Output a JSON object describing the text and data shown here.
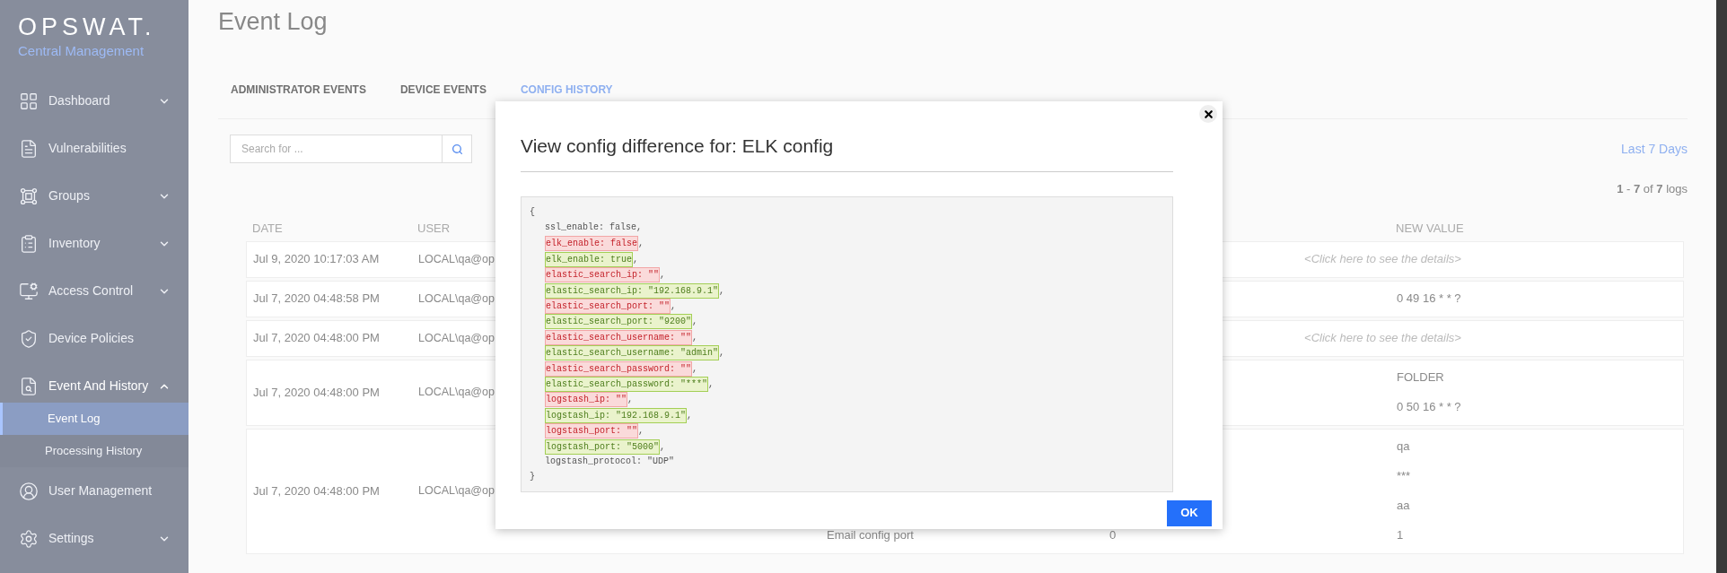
{
  "sidebar": {
    "logo": "OPSWAT.",
    "subtitle": "Central Management",
    "items": [
      {
        "label": "Dashboard",
        "expandable": true,
        "expanded": false
      },
      {
        "label": "Vulnerabilities",
        "expandable": false,
        "expanded": false
      },
      {
        "label": "Groups",
        "expandable": true,
        "expanded": false
      },
      {
        "label": "Inventory",
        "expandable": true,
        "expanded": false
      },
      {
        "label": "Access Control",
        "expandable": true,
        "expanded": false
      },
      {
        "label": "Device Policies",
        "expandable": false,
        "expanded": false
      },
      {
        "label": "Event And History",
        "expandable": true,
        "expanded": true,
        "children": [
          {
            "label": "Event Log",
            "selected": true
          },
          {
            "label": "Processing History",
            "selected": false
          }
        ]
      },
      {
        "label": "User Management",
        "expandable": false,
        "expanded": false
      },
      {
        "label": "Settings",
        "expandable": true,
        "expanded": false
      }
    ]
  },
  "page": {
    "title": "Event Log"
  },
  "tabs": [
    {
      "label": "ADMINISTRATOR EVENTS",
      "selected": false
    },
    {
      "label": "DEVICE EVENTS",
      "selected": false
    },
    {
      "label": "CONFIG HISTORY",
      "selected": true
    }
  ],
  "search": {
    "placeholder": "Search for ..."
  },
  "range": "Last 7 Days",
  "count": "**1** - **7** of **7** logs",
  "table": {
    "columns": [
      "DATE",
      "USER",
      "NEW VALUE"
    ],
    "rows": [
      {
        "date": "Jul 9, 2020 10:17:03 AM",
        "user": "LOCAL\\qa@op",
        "details": "<Click here to see the details>"
      },
      {
        "date": "Jul 7, 2020 04:48:58 PM",
        "user": "LOCAL\\qa@op",
        "lines": [
          {
            "new_value": "0 49 16 * * ?"
          }
        ]
      },
      {
        "date": "Jul 7, 2020 04:48:00 PM",
        "user": "LOCAL\\qa@op",
        "details": "<Click here to see the details>"
      },
      {
        "date": "Jul 7, 2020 04:48:00 PM",
        "user": "LOCAL\\qa@op",
        "lines": [
          {
            "new_value": "FOLDER"
          },
          {
            "new_value": "0 50 16 * * ?"
          }
        ]
      },
      {
        "date": "Jul 7, 2020 04:48:00 PM",
        "user": "LOCAL\\qa@op",
        "lines": [
          {
            "new_value": "qa"
          },
          {
            "new_value": "***"
          },
          {
            "new_value": "aa"
          },
          {
            "column_3": "Email config port",
            "column_4": "0",
            "new_value": "1"
          }
        ]
      }
    ]
  },
  "dialog": {
    "title": "View config difference for: ELK config",
    "button": "OK",
    "code": [
      {
        "kind": "brace",
        "text": "{"
      },
      {
        "kind": "plain",
        "text": "ssl_enable: false,"
      },
      {
        "kind": "removed",
        "text": "elk_enable: false",
        "suffix": ","
      },
      {
        "kind": "added",
        "text": "elk_enable: true",
        "suffix": ","
      },
      {
        "kind": "removed",
        "text": "elastic_search_ip: \"\"",
        "suffix": ","
      },
      {
        "kind": "added",
        "text": "elastic_search_ip: \"192.168.9.1\"",
        "suffix": ","
      },
      {
        "kind": "removed",
        "text": "elastic_search_port: \"\"",
        "suffix": ","
      },
      {
        "kind": "added",
        "text": "elastic_search_port: \"9200\"",
        "suffix": ","
      },
      {
        "kind": "removed",
        "text": "elastic_search_username: \"\"",
        "suffix": ","
      },
      {
        "kind": "added",
        "text": "elastic_search_username: \"admin\"",
        "suffix": ","
      },
      {
        "kind": "removed",
        "text": "elastic_search_password: \"\"",
        "suffix": ","
      },
      {
        "kind": "added",
        "text": "elastic_search_password: \"***\"",
        "suffix": ","
      },
      {
        "kind": "removed",
        "text": "logstash_ip: \"\"",
        "suffix": ","
      },
      {
        "kind": "added",
        "text": "logstash_ip: \"192.168.9.1\"",
        "suffix": ","
      },
      {
        "kind": "removed",
        "text": "logstash_port: \"\"",
        "suffix": ","
      },
      {
        "kind": "added",
        "text": "logstash_port: \"5000\"",
        "suffix": ","
      },
      {
        "kind": "plain",
        "text": "logstash_protocol: \"UDP\""
      },
      {
        "kind": "brace",
        "text": "}"
      }
    ]
  }
}
